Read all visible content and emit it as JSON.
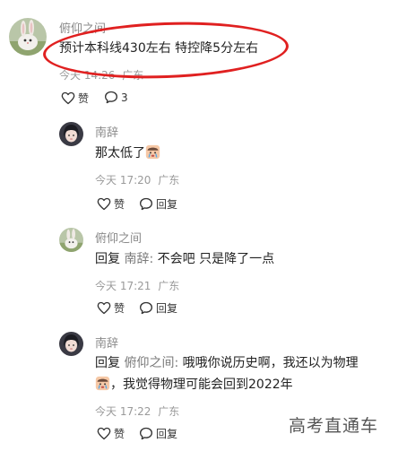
{
  "comments": [
    {
      "username": "俯仰之间",
      "text": "预计本科线430左右 特控降5分左右",
      "time": "今天 14:26",
      "location": "广东",
      "like_label": "赞",
      "reply_count": "3"
    },
    {
      "username": "南辞",
      "text": "那太低了",
      "time": "今天 17:20",
      "location": "广东",
      "like_label": "赞",
      "reply_label": "回复"
    },
    {
      "username": "俯仰之间",
      "reply_keyword": "回复",
      "reply_target": "南辞:",
      "text": "不会吧 只是降了一点",
      "time": "今天 17:21",
      "location": "广东",
      "like_label": "赞",
      "reply_label": "回复"
    },
    {
      "username": "南辞",
      "reply_keyword": "回复",
      "reply_target": "俯仰之间:",
      "text_line1": "哦哦你说历史啊，我还以为物理",
      "text_line2": "，我觉得物理可能会回到2022年",
      "time": "今天 17:22",
      "location": "广东",
      "like_label": "赞",
      "reply_label": "回复"
    }
  ],
  "watermark": "高考直通车",
  "colors": {
    "annotation_ellipse": "#e02020",
    "meta_text": "#9a9a9a",
    "username": "#8a8a8a"
  }
}
